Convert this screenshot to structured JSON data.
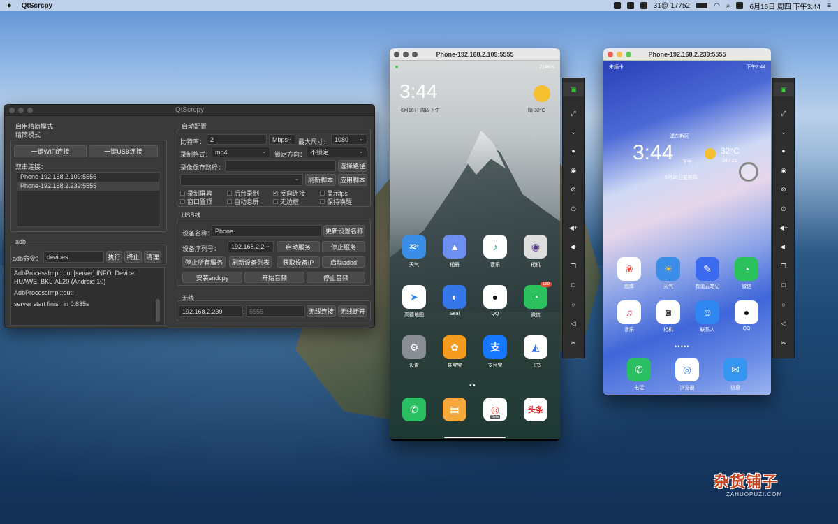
{
  "menubar": {
    "apple": "",
    "app": "QtScrcpy",
    "status_temp": "31@·17752",
    "datetime": "6月16日 周四 下午3:44"
  },
  "qt": {
    "title": "QtScrcpy",
    "mode_label": "启用精简模式",
    "mode_group": "精简模式",
    "wifi_btn": "一键WIFI连接",
    "usb_btn": "一键USB连接",
    "double_click": "双击连接：",
    "devices": [
      "Phone-192.168.2.109:5555",
      "Phone-192.168.2.239:5555"
    ],
    "adb_group": "adb",
    "adb_cmd_label": "adb命令：",
    "adb_cmd_value": "devices",
    "exec": "执行",
    "stop": "终止",
    "clear": "清理",
    "log": [
      "AdbProcessImpl::out:[server] INFO: Device: HUAWEI BKL-AL20 (Android 10)",
      "AdbProcessImpl::out:",
      "server start finish in 0.835s"
    ],
    "start_config": "启动配置",
    "bitrate_label": "比特率：",
    "bitrate_value": "2",
    "bitrate_unit": "Mbps",
    "maxsize_label": "最大尺寸：",
    "maxsize_value": "1080",
    "record_fmt_label": "录制格式：",
    "record_fmt_value": "mp4",
    "lock_dir_label": "锁定方向：",
    "lock_dir_value": "不锁定",
    "record_path_label": "录像保存路径：",
    "choose_path": "选择路径",
    "refresh_script": "刷新脚本",
    "apply_script": "应用脚本",
    "checks": [
      {
        "label": "录制屏幕",
        "checked": false
      },
      {
        "label": "后台录制",
        "checked": false
      },
      {
        "label": "反向连接",
        "checked": true
      },
      {
        "label": "显示fps",
        "checked": false
      },
      {
        "label": "窗口置顶",
        "checked": false
      },
      {
        "label": "自动息屏",
        "checked": false
      },
      {
        "label": "无边框",
        "checked": false
      },
      {
        "label": "保持唤醒",
        "checked": false
      }
    ],
    "usb_group": "USB线",
    "device_name_label": "设备名称：",
    "device_name_value": "Phone",
    "update_name": "更新设置名称",
    "serial_label": "设备序列号：",
    "serial_value": "192.168.2.2",
    "start_service": "启动服务",
    "stop_service": "停止服务",
    "stop_all": "停止所有服务",
    "refresh_list": "刷新设备列表",
    "get_ip": "获取设备IP",
    "start_adbd": "启动adbd",
    "install_sndcpy": "安装sndcpy",
    "start_audio": "开始音频",
    "stop_audio": "停止音频",
    "wireless_group": "无线",
    "ip_value": "192.168.2.239",
    "port_placeholder": "5555",
    "wireless_connect": "无线连接",
    "wireless_disconnect": "无线断开"
  },
  "phone1": {
    "title": "Phone-192.168.2.109:5555",
    "status_right": "214K/s",
    "time": "3:44",
    "date": "6月16日 周四下午",
    "weather": "晴  32°C",
    "apps": [
      "天气",
      "相册",
      "音乐",
      "相机",
      "高德地图",
      "Seal",
      "QQ",
      "微信",
      "设置",
      "亲宝宝",
      "支付宝",
      "飞书"
    ],
    "weather_icon_text": "32°",
    "badge": "189",
    "dock_toutiao": "头条",
    "beta": "Beta"
  },
  "phone2": {
    "title": "Phone-192.168.2.239:5555",
    "status_left": "未插卡",
    "status_right": "下午3:44",
    "location": "浦东新区",
    "time": "3:44",
    "ampm": "下午",
    "temp": "32°C",
    "temp_range": "34 / 21",
    "date": "6月16日星期四",
    "apps": [
      "图库",
      "天气",
      "有道云笔记",
      "微信",
      "音乐",
      "相机",
      "联系人",
      "QQ"
    ],
    "dock": [
      "电话",
      "浏览器",
      "信息"
    ]
  },
  "watermark": {
    "main": "杂货铺子",
    "sub": "ZAHUOPUZI.COM"
  }
}
